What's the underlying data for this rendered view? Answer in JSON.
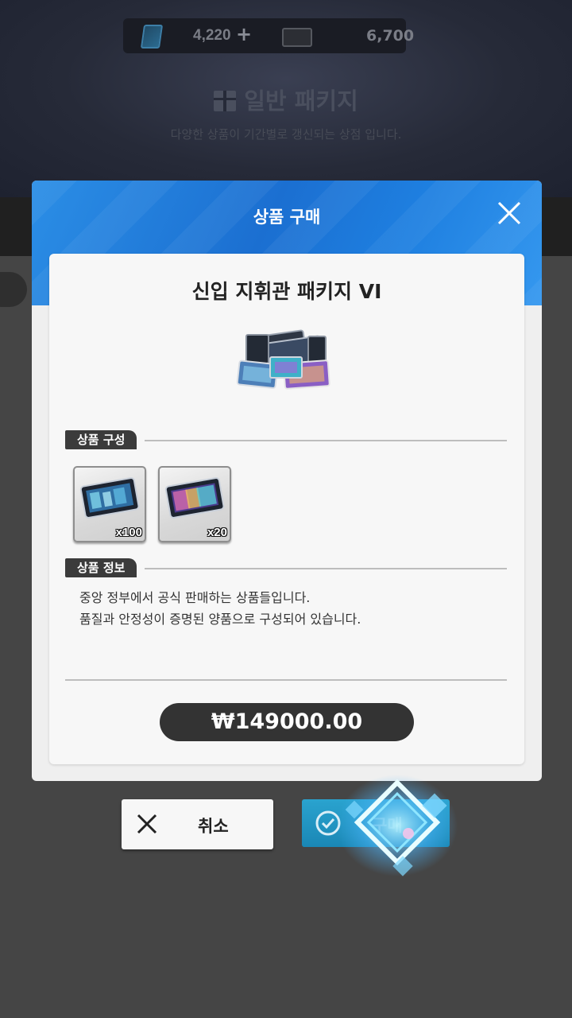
{
  "header": {
    "currency_ticket": "4,220",
    "currency_plus": "+",
    "currency_gem": "6,700",
    "shop_title": "일반 패키지",
    "shop_subtitle": "다양한 상품이 기간별로 갱신되는 상점 입니다."
  },
  "dialog": {
    "title": "상품 구매",
    "package_name": "신입 지휘관 패키지 VI",
    "contents_label": "상품 구성",
    "items": [
      {
        "icon": "ticket-bundle-blue-icon",
        "count": "x100"
      },
      {
        "icon": "ticket-bundle-rainbow-icon",
        "count": "x20"
      }
    ],
    "info_label": "상품 정보",
    "info_lines": [
      "중앙 정부에서 공식 판매하는 상품들입니다.",
      "품질과 안정성이 증명된 양품으로 구성되어 있습니다."
    ],
    "price": "₩149000.00"
  },
  "actions": {
    "cancel_label": "취소",
    "confirm_label": "구매"
  },
  "colors": {
    "header_blue": "#1b6fd1",
    "confirm_teal": "#1a87b5",
    "price_bg": "#333333"
  }
}
